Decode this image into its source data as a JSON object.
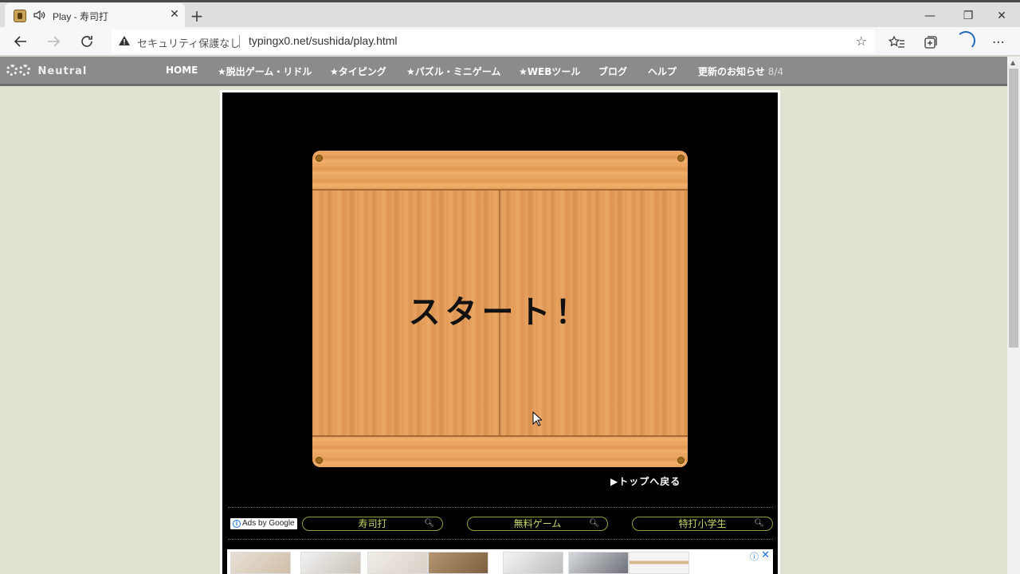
{
  "browser": {
    "tab_title": "Play - 寿司打",
    "tab_close": "✕",
    "new_tab": "+",
    "win_minimize": "—",
    "win_restore": "❐",
    "win_close": "✕",
    "security_label": "セキュリティ保護なし",
    "url": "typingx0.net/sushida/play.html"
  },
  "site_nav": {
    "logo": "Neutral",
    "items": [
      {
        "label": "HOME"
      },
      {
        "label": "★脱出ゲーム・リドル"
      },
      {
        "label": "★タイピング"
      },
      {
        "label": "★パズル・ミニゲーム"
      },
      {
        "label": "★WEBツール"
      },
      {
        "label": "ブログ"
      },
      {
        "label": "ヘルプ"
      },
      {
        "label": "更新のお知らせ",
        "date": "8/4"
      }
    ]
  },
  "game": {
    "start_text": "スタート！",
    "back_link": "▶トップへ戻る"
  },
  "ads": {
    "badge": "Ads by Google",
    "links": [
      "寿司打",
      "無料ゲーム",
      "特打小学生"
    ]
  },
  "colors": {
    "page_bg": "#dfe3d1",
    "nav_bg": "#8b8b8b",
    "game_bg": "#000000",
    "wood": "#e39a56",
    "ad_link": "#c9d86a"
  }
}
